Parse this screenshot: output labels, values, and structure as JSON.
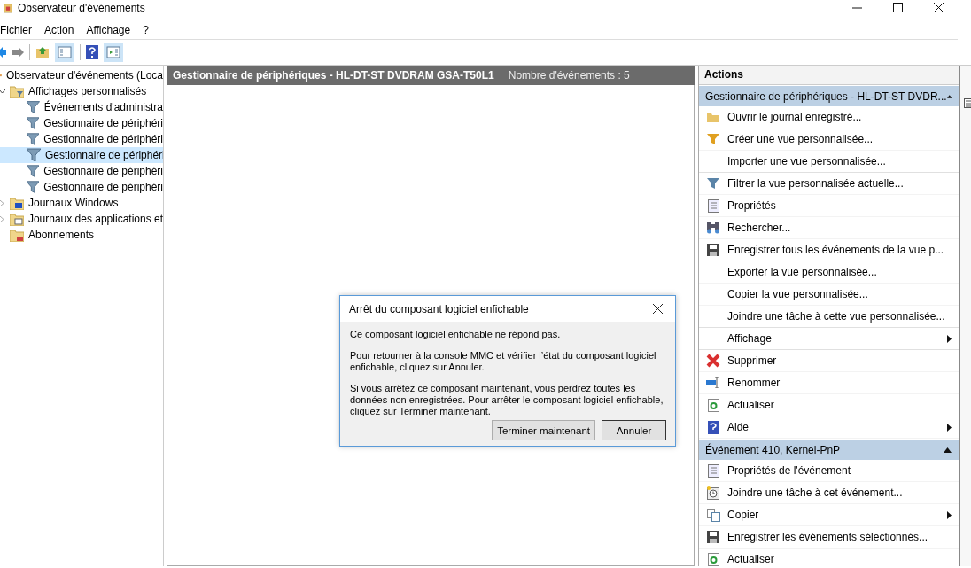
{
  "window": {
    "title": "Observateur d'événements"
  },
  "menu": [
    "Fichier",
    "Action",
    "Affichage",
    "?"
  ],
  "tree": [
    {
      "label": "Observateur d'événements (Loca",
      "selected": false,
      "children": [
        {
          "label": "Affichages personnalisés",
          "selected": false,
          "expanded": true,
          "children": [
            {
              "label": "Événements d'administra",
              "selected": false
            },
            {
              "label": "Gestionnaire de périphéri",
              "selected": false
            },
            {
              "label": "Gestionnaire de périphéri",
              "selected": false
            },
            {
              "label": "Gestionnaire de périphéri",
              "selected": true
            },
            {
              "label": "Gestionnaire de périphéri",
              "selected": false
            },
            {
              "label": "Gestionnaire de périphéri",
              "selected": false
            }
          ]
        },
        {
          "label": "Journaux Windows",
          "selected": false,
          "expanded": false
        },
        {
          "label": "Journaux des applications et",
          "selected": false,
          "expanded": false
        },
        {
          "label": "Abonnements",
          "selected": false
        }
      ]
    }
  ],
  "center": {
    "title": "Gestionnaire de périphériques - HL-DT-ST DVDRAM GSA-T50L1",
    "count": "Nombre d'événements : 5"
  },
  "actions": {
    "title": "Actions",
    "sections": [
      {
        "title": "Gestionnaire de périphériques - HL-DT-ST DVDR...",
        "expanded": true,
        "items": [
          {
            "label": "Ouvrir le journal enregistré...",
            "submenu": false
          },
          {
            "label": "Créer une vue personnalisée...",
            "submenu": false
          },
          {
            "label": "Importer une vue personnalisée...",
            "submenu": false
          },
          {
            "label": "Filtrer la vue personnalisée actuelle...",
            "submenu": false
          },
          {
            "label": "Propriétés",
            "submenu": false
          },
          {
            "label": "Rechercher...",
            "submenu": false
          },
          {
            "label": "Enregistrer tous les événements de la vue p...",
            "submenu": false
          },
          {
            "label": "Exporter la vue personnalisée...",
            "submenu": false
          },
          {
            "label": "Copier la vue personnalisée...",
            "submenu": false
          },
          {
            "label": "Joindre une tâche à cette vue personnalisée...",
            "submenu": false
          },
          {
            "label": "Affichage",
            "submenu": true
          },
          {
            "label": "Supprimer",
            "submenu": false
          },
          {
            "label": "Renommer",
            "submenu": false
          },
          {
            "label": "Actualiser",
            "submenu": false
          },
          {
            "label": "Aide",
            "submenu": true
          }
        ]
      },
      {
        "title": "Événement 410, Kernel-PnP",
        "expanded": true,
        "items": [
          {
            "label": "Propriétés de l'événement",
            "submenu": false
          },
          {
            "label": "Joindre une tâche à cet événement...",
            "submenu": false
          },
          {
            "label": "Copier",
            "submenu": true
          },
          {
            "label": "Enregistrer les événements sélectionnés...",
            "submenu": false
          },
          {
            "label": "Actualiser",
            "submenu": false
          }
        ]
      }
    ]
  },
  "dialog": {
    "title": "Arrêt du composant logiciel enfichable",
    "paragraphs": [
      "Ce composant logiciel enfichable ne répond pas.",
      "Pour retourner à la console MMC et vérifier l’état du composant logiciel enfichable, cliquez sur Annuler.",
      "Si vous arrêtez ce composant maintenant, vous perdrez toutes les données non enregistrées. Pour arrêter le composant logiciel enfichable, cliquez sur Terminer maintenant."
    ],
    "buttons": [
      "Terminer maintenant",
      "Annuler"
    ]
  }
}
